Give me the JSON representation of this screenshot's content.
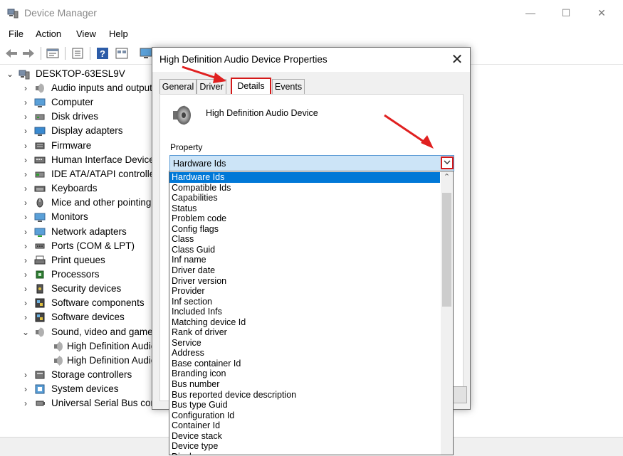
{
  "window": {
    "title": "Device Manager",
    "minimize": "—",
    "maximize": "☐",
    "close": "✕"
  },
  "menu": [
    "File",
    "Action",
    "View",
    "Help"
  ],
  "toolbar_icons": [
    "back-arrow-icon",
    "forward-arrow-icon",
    "properties-icon",
    "update-driver-icon",
    "help-icon",
    "show-hidden-icon",
    "monitor-icon"
  ],
  "tree": {
    "root": "DESKTOP-63ESL9V",
    "categories": [
      {
        "label": "Audio inputs and outputs",
        "icon": "speaker-icon"
      },
      {
        "label": "Computer",
        "icon": "computer-icon"
      },
      {
        "label": "Disk drives",
        "icon": "disk-icon"
      },
      {
        "label": "Display adapters",
        "icon": "display-icon"
      },
      {
        "label": "Firmware",
        "icon": "firmware-icon"
      },
      {
        "label": "Human Interface Devices",
        "icon": "hid-icon"
      },
      {
        "label": "IDE ATA/ATAPI controllers",
        "icon": "ide-icon"
      },
      {
        "label": "Keyboards",
        "icon": "keyboard-icon"
      },
      {
        "label": "Mice and other pointing devices",
        "icon": "mouse-icon"
      },
      {
        "label": "Monitors",
        "icon": "monitor-icon"
      },
      {
        "label": "Network adapters",
        "icon": "network-icon"
      },
      {
        "label": "Ports (COM & LPT)",
        "icon": "port-icon"
      },
      {
        "label": "Print queues",
        "icon": "printer-icon"
      },
      {
        "label": "Processors",
        "icon": "processor-icon"
      },
      {
        "label": "Security devices",
        "icon": "security-icon"
      },
      {
        "label": "Software components",
        "icon": "software-icon"
      },
      {
        "label": "Software devices",
        "icon": "software-icon"
      },
      {
        "label": "Sound, video and game controllers",
        "icon": "speaker-icon",
        "expanded": true
      },
      {
        "label": "High Definition Audio Device",
        "icon": "speaker-icon",
        "child": true
      },
      {
        "label": "High Definition Audio Device",
        "icon": "speaker-icon",
        "child": true
      },
      {
        "label": "Storage controllers",
        "icon": "storage-icon"
      },
      {
        "label": "System devices",
        "icon": "system-icon"
      },
      {
        "label": "Universal Serial Bus controllers",
        "icon": "usb-icon"
      }
    ]
  },
  "dialog": {
    "title": "High Definition Audio Device Properties",
    "close": "✕",
    "tabs": [
      "General",
      "Driver",
      "Details",
      "Events"
    ],
    "active_tab": "Details",
    "device_name": "High Definition Audio Device",
    "property_label": "Property",
    "property_value": "Hardware Ids",
    "options": [
      "Hardware Ids",
      "Compatible Ids",
      "Capabilities",
      "Status",
      "Problem code",
      "Config flags",
      "Class",
      "Class Guid",
      "Inf name",
      "Driver date",
      "Driver version",
      "Provider",
      "Inf section",
      "Included Infs",
      "Matching device Id",
      "Rank of driver",
      "Service",
      "Address",
      "Base container Id",
      "Branding icon",
      "Bus number",
      "Bus reported device description",
      "Bus type Guid",
      "Configuration Id",
      "Container Id",
      "Device stack",
      "Device type",
      "Display name"
    ],
    "selected_option": "Hardware Ids"
  },
  "colors": {
    "selection": "#0078d7",
    "annotation": "#d41919",
    "combo_bg": "#cce4f7"
  }
}
